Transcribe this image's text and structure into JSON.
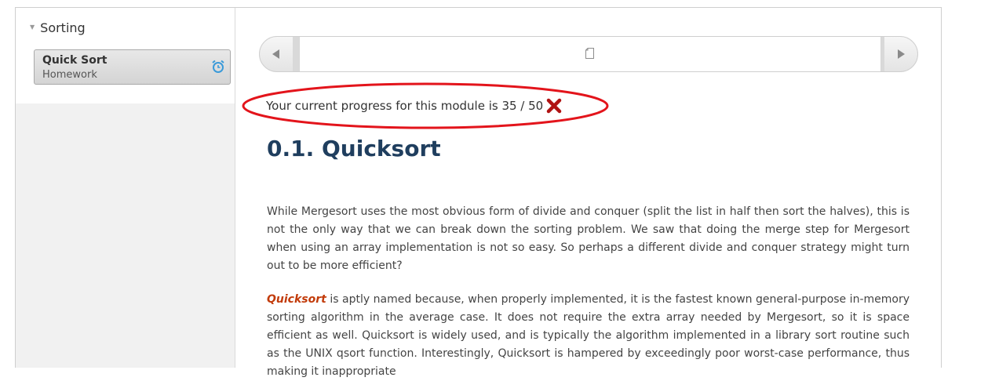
{
  "sidebar": {
    "section_title": "Sorting",
    "item": {
      "title": "Quick Sort",
      "subtitle": "Homework",
      "icon": "alarm-clock-icon",
      "icon_color": "#3a9ad9"
    }
  },
  "navigation": {
    "prev_icon": "triangle-left-icon",
    "next_icon": "triangle-right-icon",
    "center_icon": "document-icon"
  },
  "progress": {
    "text": "Your current progress for this module is 35 /  50",
    "current": 35,
    "total": 50,
    "status_icon": "incomplete-x-icon",
    "status_color": "#b01313",
    "annotation_color": "#e3141b"
  },
  "content": {
    "heading": "0.1. Quicksort",
    "heading_color": "#1f3e5e",
    "paragraph1": "While Mergesort uses the most obvious form of divide and conquer (split the list in half then sort the halves), this is not the only way that we can break down the sorting problem. We saw that doing the merge step for Mergesort when using an array implementation is not so easy. So perhaps a different divide and conquer strategy might turn out to be more efficient?",
    "term": "Quicksort",
    "term_color": "#c23b0a",
    "paragraph2_rest": " is aptly named because, when properly implemented, it is the fastest known general-purpose in-memory sorting algorithm in the average case. It does not require the extra array needed by Mergesort, so it is space efficient as well. Quicksort is widely used, and is typically the algorithm implemented in a library sort routine such as the UNIX qsort function. Interestingly, Quicksort is hampered by exceedingly poor worst-case performance, thus making it inappropriate"
  }
}
